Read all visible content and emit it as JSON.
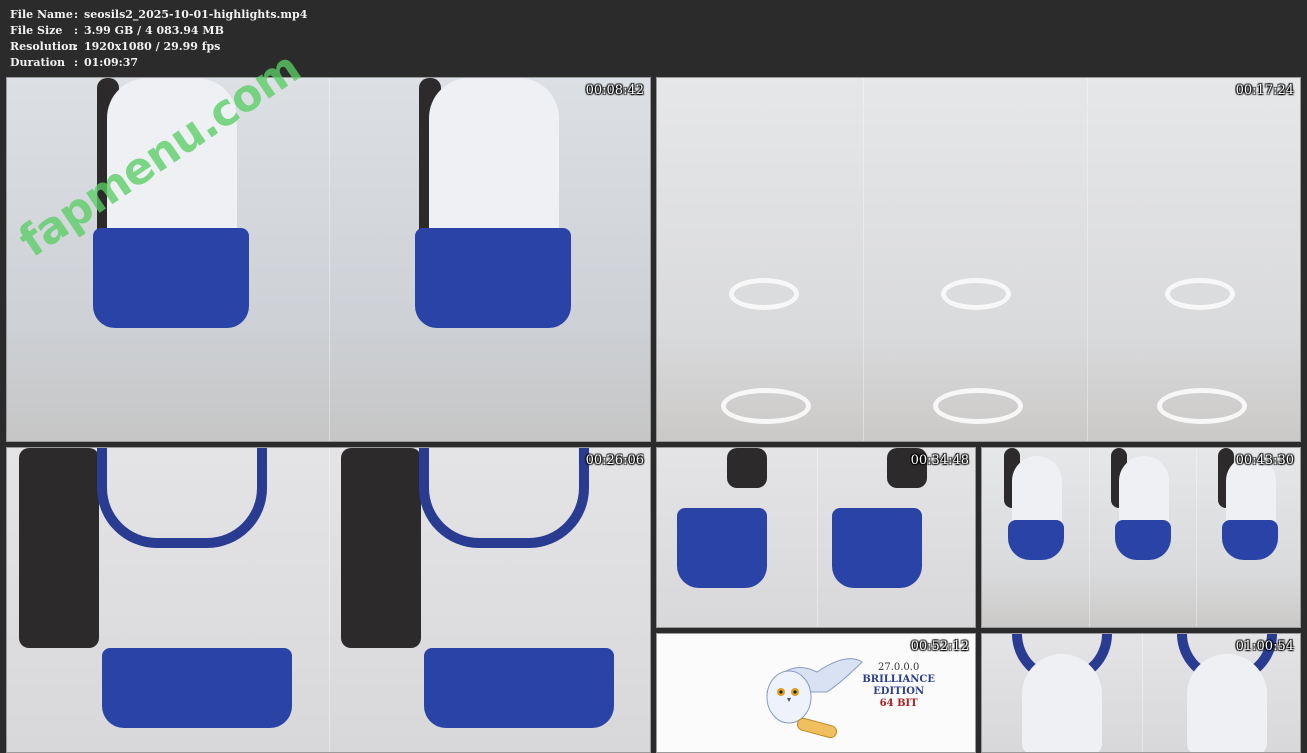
{
  "info": {
    "rows": [
      {
        "label": "File Name",
        "sep": ":",
        "value": "seosils2_2025-10-01-highlights.mp4"
      },
      {
        "label": "File Size",
        "sep": ":",
        "value": "3.99 GB / 4 083.94 MB"
      },
      {
        "label": "Resolution",
        "sep": ":",
        "value": "1920x1080 / 29.99 fps"
      },
      {
        "label": "Duration",
        "sep": ":",
        "value": "01:09:37"
      }
    ]
  },
  "watermark": "fapmenu.com",
  "thumbnails": [
    {
      "timestamp": "00:08:42"
    },
    {
      "timestamp": "00:17:24"
    },
    {
      "timestamp": "00:26:06"
    },
    {
      "timestamp": "00:34:48"
    },
    {
      "timestamp": "00:43:30"
    },
    {
      "timestamp": "00:52:12",
      "overlay": {
        "version": "27.0.0.0",
        "line1": "BRILLIANCE",
        "line2": "EDITION",
        "bits": "64 BIT"
      }
    },
    {
      "timestamp": "01:00:54"
    }
  ],
  "colors": {
    "background": "#2b2b2b",
    "text": "#f2f2f2",
    "watermark": "#5acd64",
    "shorts": "#2a43a6"
  }
}
